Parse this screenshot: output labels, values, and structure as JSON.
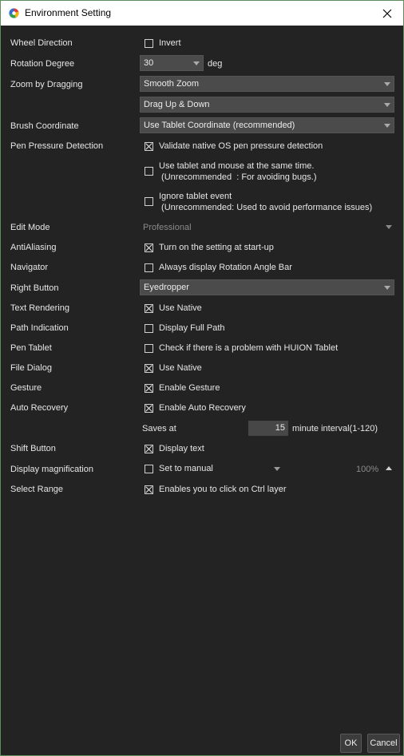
{
  "window": {
    "title": "Environment Setting"
  },
  "settings": {
    "wheel_direction": {
      "label": "Wheel Direction",
      "checkbox_label": "Invert",
      "checked": false
    },
    "rotation_degree": {
      "label": "Rotation Degree",
      "value": "30",
      "unit": "deg"
    },
    "zoom_by_dragging": {
      "label": "Zoom by Dragging",
      "value": "Smooth Zoom",
      "value2": "Drag Up & Down"
    },
    "brush_coordinate": {
      "label": "Brush Coordinate",
      "value": "Use Tablet Coordinate (recommended)"
    },
    "pen_pressure": {
      "label": "Pen Pressure Detection",
      "options": [
        {
          "text": "Validate native OS pen pressure detection",
          "checked": true
        },
        {
          "text": "Use tablet and mouse at the same time.\n (Unrecommended  : For avoiding bugs.)",
          "checked": false
        },
        {
          "text": "Ignore tablet event\n (Unrecommended: Used to avoid performance issues)",
          "checked": false
        }
      ]
    },
    "edit_mode": {
      "label": "Edit Mode",
      "value": "Professional"
    },
    "antialiasing": {
      "label": "AntiAliasing",
      "checkbox_label": "Turn on the setting at start-up",
      "checked": true
    },
    "navigator": {
      "label": "Navigator",
      "checkbox_label": "Always display Rotation Angle Bar",
      "checked": false
    },
    "right_button": {
      "label": "Right Button",
      "value": "Eyedropper"
    },
    "text_rendering": {
      "label": "Text Rendering",
      "checkbox_label": "Use Native",
      "checked": true
    },
    "path_indication": {
      "label": "Path Indication",
      "checkbox_label": "Display Full Path",
      "checked": false
    },
    "pen_tablet": {
      "label": "Pen Tablet",
      "checkbox_label": "Check if there is a problem with HUION Tablet",
      "checked": false
    },
    "file_dialog": {
      "label": "File Dialog",
      "checkbox_label": "Use Native",
      "checked": true
    },
    "gesture": {
      "label": "Gesture",
      "checkbox_label": "Enable Gesture",
      "checked": true
    },
    "auto_recovery": {
      "label": "Auto Recovery",
      "checkbox_label": "Enable Auto Recovery",
      "checked": true,
      "saves_at_label": "Saves at",
      "interval_value": "15",
      "interval_suffix": "minute interval(1-120)"
    },
    "shift_button": {
      "label": "Shift Button",
      "checkbox_label": "Display text",
      "checked": true
    },
    "display_magnification": {
      "label": "Display magnification",
      "checkbox_label": "Set to manual",
      "checked": false,
      "value": "100%"
    },
    "select_range": {
      "label": "Select Range",
      "checkbox_label": "Enables you to click on Ctrl layer",
      "checked": true
    }
  },
  "buttons": {
    "ok": "OK",
    "cancel": "Cancel"
  }
}
